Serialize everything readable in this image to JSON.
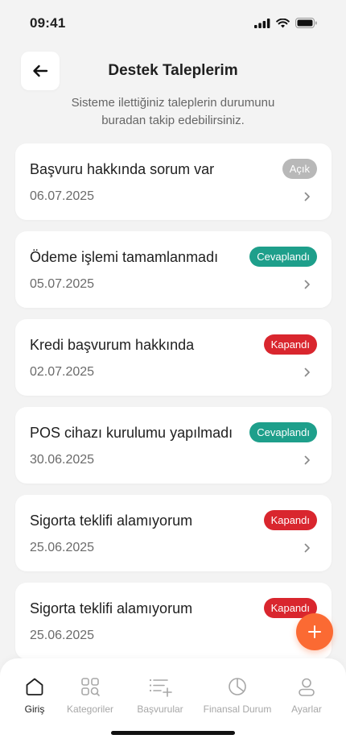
{
  "status_bar": {
    "time": "09:41"
  },
  "header": {
    "title": "Destek Taleplerim",
    "subtitle": "Sisteme ilettiğiniz taleplerin durumunu buradan takip edebilirsiniz."
  },
  "tickets": [
    {
      "title": "Başvuru hakkında sorum var",
      "date": "06.07.2025",
      "status": "Açık",
      "status_color": "#b8b8b8"
    },
    {
      "title": "Ödeme işlemi tamamlanmadı",
      "date": "05.07.2025",
      "status": "Cevaplandı",
      "status_color": "#1e9f8b"
    },
    {
      "title": "Kredi başvurum hakkında",
      "date": "02.07.2025",
      "status": "Kapandı",
      "status_color": "#d9262e"
    },
    {
      "title": "POS cihazı kurulumu yapılmadı",
      "date": "30.06.2025",
      "status": "Cevaplandı",
      "status_color": "#1e9f8b"
    },
    {
      "title": "Sigorta teklifi alamıyorum",
      "date": "25.06.2025",
      "status": "Kapandı",
      "status_color": "#d9262e"
    },
    {
      "title": "Sigorta teklifi alamıyorum",
      "date": "25.06.2025",
      "status": "Kapandı",
      "status_color": "#d9262e"
    }
  ],
  "nav": {
    "items": [
      {
        "label": "Giriş",
        "icon": "home-icon",
        "active": true
      },
      {
        "label": "Kategoriler",
        "icon": "categories-icon",
        "active": false
      },
      {
        "label": "Başvurular",
        "icon": "list-add-icon",
        "active": false
      },
      {
        "label": "Finansal Durum",
        "icon": "pie-chart-icon",
        "active": false
      },
      {
        "label": "Ayarlar",
        "icon": "user-icon",
        "active": false
      }
    ]
  },
  "colors": {
    "accent": "#fb6a33",
    "background": "#f3f3f3",
    "answered": "#1e9f8b",
    "closed": "#d9262e",
    "open": "#b8b8b8"
  }
}
